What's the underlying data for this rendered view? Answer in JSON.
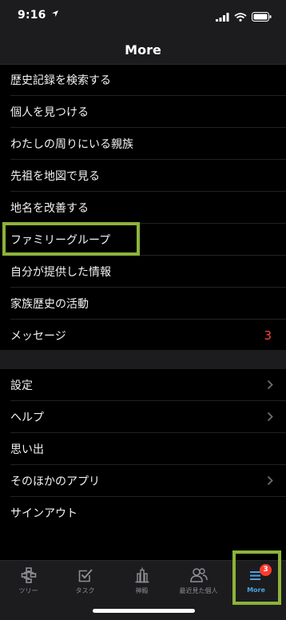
{
  "status": {
    "time": "9:16"
  },
  "header": {
    "title": "More"
  },
  "list_primary": [
    {
      "label": "歴史記録を検索する"
    },
    {
      "label": "個人を見つける"
    },
    {
      "label": "わたしの周りにいる親族"
    },
    {
      "label": "先祖を地図で見る"
    },
    {
      "label": "地名を改善する"
    },
    {
      "label": "ファミリーグループ"
    },
    {
      "label": "自分が提供した情報"
    },
    {
      "label": "家族歴史の活動"
    },
    {
      "label": "メッセージ",
      "count": "3"
    }
  ],
  "list_secondary": [
    {
      "label": "設定"
    },
    {
      "label": "ヘルプ"
    },
    {
      "label": "思い出"
    },
    {
      "label": "そのほかのアプリ"
    },
    {
      "label": "サインアウト"
    }
  ],
  "tabs": [
    {
      "label": "ツリー",
      "icon": "tree-icon"
    },
    {
      "label": "タスク",
      "icon": "task-icon"
    },
    {
      "label": "神殿",
      "icon": "temple-icon"
    },
    {
      "label": "最近見た個人",
      "icon": "people-icon"
    },
    {
      "label": "More",
      "icon": "menu-icon",
      "badge": "3"
    }
  ],
  "colors": {
    "accent": "#4aa3df",
    "badge": "#ff3b30",
    "highlight": "#8db33a",
    "count": "#ff453a"
  }
}
